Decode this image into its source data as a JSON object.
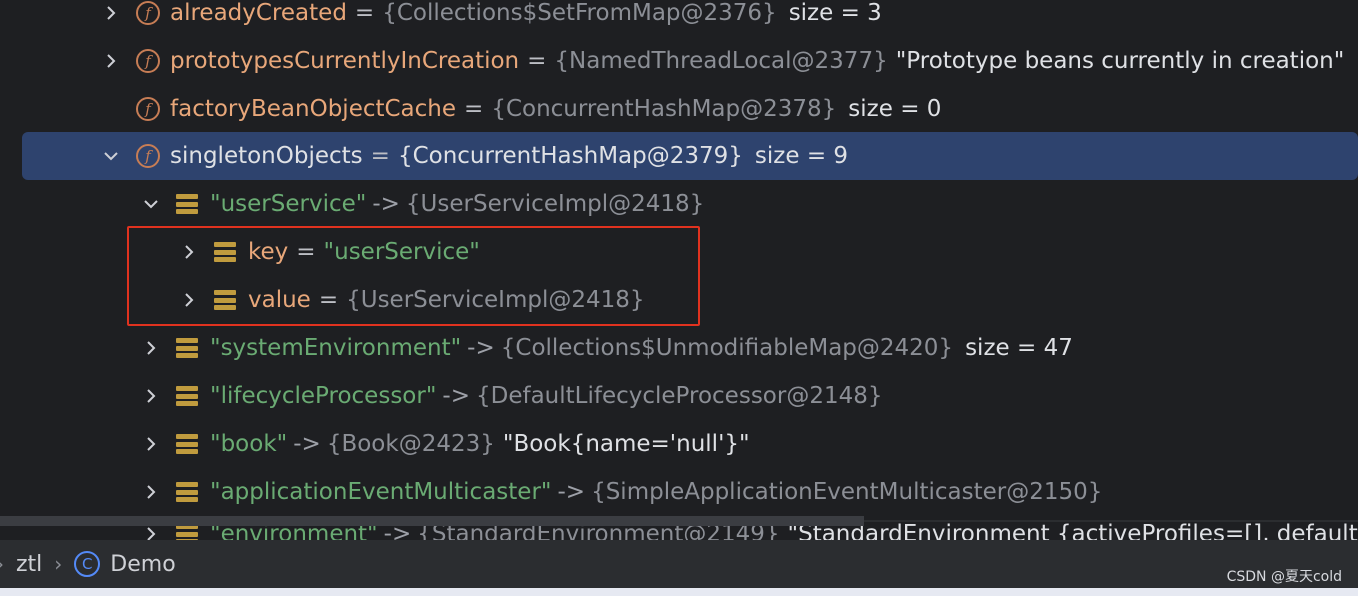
{
  "rows": [
    {
      "chev": "right",
      "icon": "f",
      "name": "alreadyCreated",
      "ref": "{Collections$SetFromMap@2376}",
      "extra": "size = 3"
    },
    {
      "chev": "right",
      "icon": "f",
      "name": "prototypesCurrentlyInCreation",
      "ref": "{NamedThreadLocal@2377}",
      "extra": "\"Prototype beans currently in creation\""
    },
    {
      "chev": "none",
      "icon": "f",
      "name": "factoryBeanObjectCache",
      "ref": "{ConcurrentHashMap@2378}",
      "extra": "size = 0"
    },
    {
      "chev": "down",
      "icon": "f",
      "name": "singletonObjects",
      "ref": "{ConcurrentHashMap@2379}",
      "extra": "size = 9"
    },
    {
      "chev": "down",
      "icon": "bars",
      "key": "\"userService\"",
      "ref": "{UserServiceImpl@2418}"
    },
    {
      "chev": "right",
      "icon": "bars",
      "name": "key",
      "str": "\"userService\""
    },
    {
      "chev": "right",
      "icon": "bars",
      "name": "value",
      "ref": "{UserServiceImpl@2418}"
    },
    {
      "chev": "right",
      "icon": "bars",
      "key": "\"systemEnvironment\"",
      "ref": "{Collections$UnmodifiableMap@2420}",
      "extra": "size = 47"
    },
    {
      "chev": "right",
      "icon": "bars",
      "key": "\"lifecycleProcessor\"",
      "ref": "{DefaultLifecycleProcessor@2148}"
    },
    {
      "chev": "right",
      "icon": "bars",
      "key": "\"book\"",
      "ref": "{Book@2423}",
      "extra": "\"Book{name='null'}\""
    },
    {
      "chev": "right",
      "icon": "bars",
      "key": "\"applicationEventMulticaster\"",
      "ref": "{SimpleApplicationEventMulticaster@2150}"
    }
  ],
  "operators": {
    "equals": "=",
    "arrow": "->"
  },
  "partial_row": {
    "key": "\"environment\"",
    "ref": "{StandardEnvironment@2149}",
    "extra": "\"StandardEnvironment {activeProfiles=[], defaultP"
  },
  "statusbar": {
    "crumb_1": "ztl",
    "crumb_2": "Demo",
    "class_icon_letter": "C"
  },
  "watermark": "CSDN @夏天cold"
}
